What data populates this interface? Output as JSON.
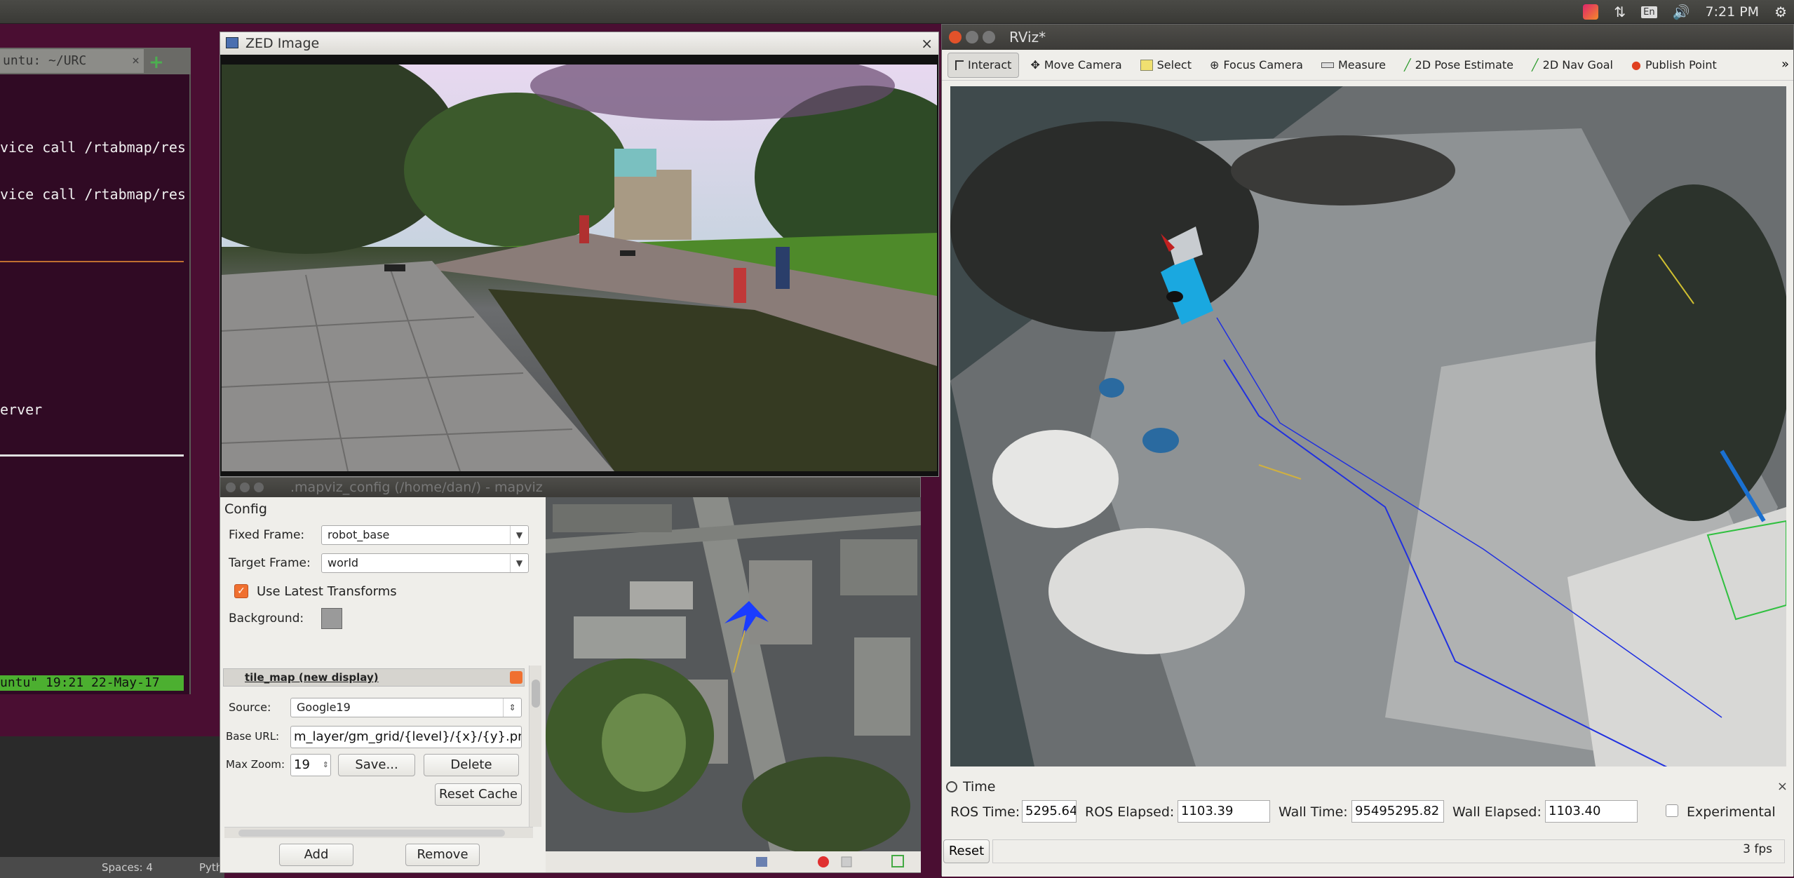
{
  "tray": {
    "keyboard_label": "En",
    "clock": "7:21 PM"
  },
  "terminal": {
    "tab_title": "untu: ~/URC",
    "tab_close": "×",
    "lines": [
      "vice call /rtabmap/res",
      "vice call /rtabmap/res",
      "erver"
    ],
    "status_line": "untu\" 19:21 22-May-17"
  },
  "editor_status": {
    "spaces": "Spaces: 4",
    "lang": "Pyth"
  },
  "zed": {
    "title": "ZED Image"
  },
  "mapviz": {
    "title": ".mapviz_config (/home/dan/) - mapviz",
    "config_header": "Config",
    "fixed_frame_label": "Fixed Frame:",
    "fixed_frame_value": "robot_base",
    "target_frame_label": "Target Frame:",
    "target_frame_value": "world",
    "use_latest_label": "Use Latest Transforms",
    "background_label": "Background:",
    "display_title": "tile_map (new display)",
    "source_label": "Source:",
    "source_value": "Google19",
    "base_url_label": "Base URL:",
    "base_url_value": "m_layer/gm_grid/{level}/{x}/{y}.png",
    "max_zoom_label": "Max Zoom:",
    "max_zoom_value": "19",
    "save_label": "Save...",
    "delete_label": "Delete",
    "reset_cache_label": "Reset Cache",
    "add_label": "Add",
    "remove_label": "Remove"
  },
  "rviz": {
    "title": "RViz*",
    "tools": [
      {
        "label": "Interact",
        "icon": "cursor-icon",
        "active": true
      },
      {
        "label": "Move Camera",
        "icon": "move-camera-icon",
        "active": false
      },
      {
        "label": "Select",
        "icon": "select-icon",
        "active": false
      },
      {
        "label": "Focus Camera",
        "icon": "focus-icon",
        "active": false
      },
      {
        "label": "Measure",
        "icon": "measure-icon",
        "active": false
      },
      {
        "label": "2D Pose Estimate",
        "icon": "pose-estimate-icon",
        "active": false
      },
      {
        "label": "2D Nav Goal",
        "icon": "nav-goal-icon",
        "active": false
      },
      {
        "label": "Publish Point",
        "icon": "publish-point-icon",
        "active": false
      }
    ],
    "overflow": "»",
    "time_header": "Time",
    "ros_time_label": "ROS Time:",
    "ros_time_value": "5295.64",
    "ros_elapsed_label": "ROS Elapsed:",
    "ros_elapsed_value": "1103.39",
    "wall_time_label": "Wall Time:",
    "wall_time_value": "95495295.82",
    "wall_elapsed_label": "Wall Elapsed:",
    "wall_elapsed_value": "1103.40",
    "experimental_label": "Experimental",
    "reset_label": "Reset",
    "fps": "3 fps"
  },
  "colors": {
    "terminal_bg": "#300a24",
    "accent_orange": "#f07030",
    "status_green": "#4caf30",
    "path_blue": "#2030e0"
  }
}
